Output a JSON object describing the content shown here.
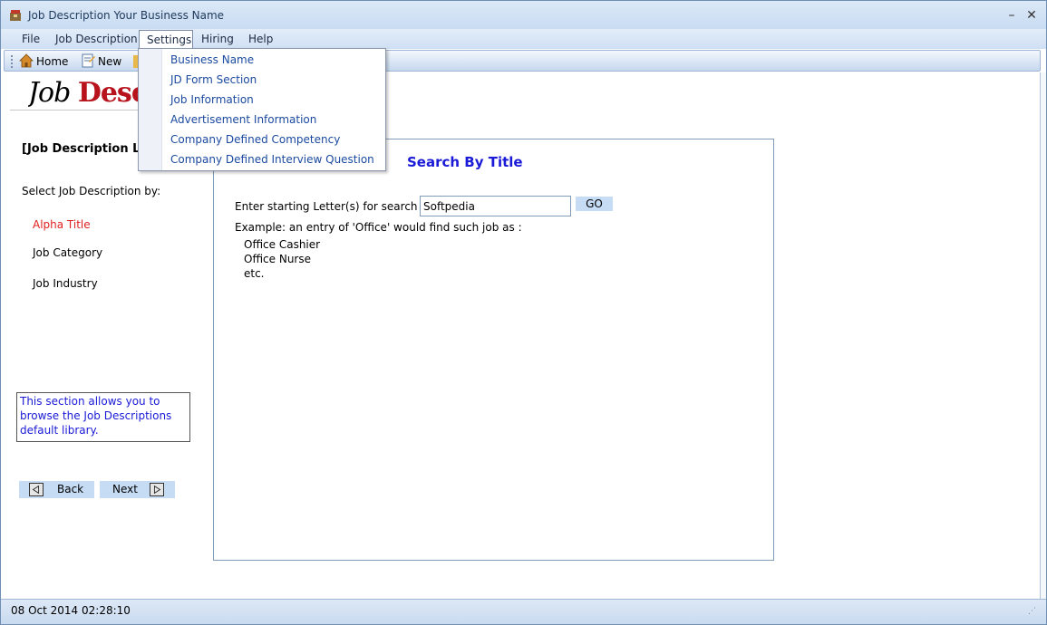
{
  "window": {
    "title": "Job Description Your Business Name",
    "minimize": "–",
    "close": "✕"
  },
  "menubar": {
    "items": [
      "File",
      "Job Description",
      "Settings",
      "Hiring",
      "Help"
    ]
  },
  "toolbar": {
    "home_label": "Home",
    "new_label": "New"
  },
  "logo": {
    "part1": "Job ",
    "part2": "Descript"
  },
  "left": {
    "heading": "[Job Description L",
    "select_by": "Select Job Description by:",
    "options": [
      "Alpha Title",
      "Job Category",
      "Job Industry"
    ],
    "info": "This section allows you to browse the Job Descriptions default library.",
    "back_label": "Back",
    "next_label": "Next"
  },
  "search": {
    "title": "Search By Title",
    "label": "Enter starting Letter(s) for search",
    "value": "Softpedia",
    "go_label": "GO",
    "example": "Example: an entry of 'Office' would find such job as :",
    "examples": [
      "Office Cashier",
      "Office Nurse",
      "etc."
    ]
  },
  "settings_menu": {
    "items": [
      "Business Name",
      "JD Form Section",
      "Job Information",
      "Advertisement Information",
      "Company Defined Competency",
      "Company Defined Interview Question"
    ]
  },
  "status": {
    "datetime": "08 Oct 2014 02:28:10"
  },
  "colors": {
    "accent_blue": "#1a1ad8",
    "active_red": "#e02020",
    "button_bg": "#c6dcf5"
  }
}
